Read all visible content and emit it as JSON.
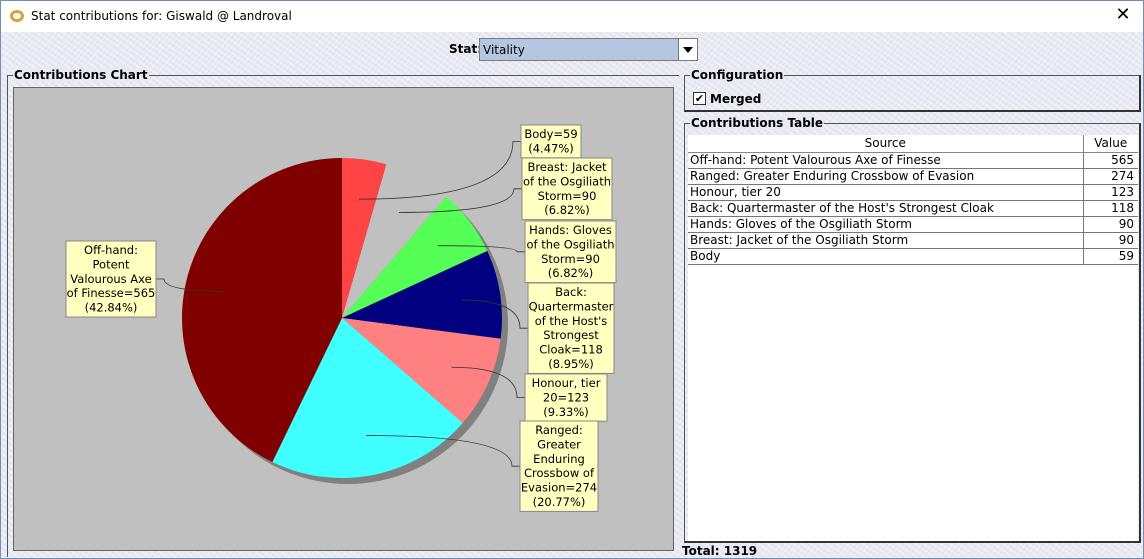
{
  "window": {
    "title": "Stat contributions for: Giswald @ Landroval",
    "close_glyph": "✕"
  },
  "stat": {
    "label": "Stat:",
    "selected": "Vitality"
  },
  "chart_panel": {
    "title": "Contributions Chart"
  },
  "config_panel": {
    "title": "Configuration",
    "merged_label": "Merged",
    "merged_checked": true,
    "check_glyph": "✔"
  },
  "table_panel": {
    "title": "Contributions Table",
    "columns": [
      "Source",
      "Value"
    ],
    "rows": [
      {
        "source": "Off-hand: Potent Valourous Axe of Finesse",
        "value": "565"
      },
      {
        "source": "Ranged: Greater Enduring Crossbow of Evasion",
        "value": "274"
      },
      {
        "source": "Honour, tier 20",
        "value": "123"
      },
      {
        "source": "Back: Quartermaster of the Host's Strongest Cloak",
        "value": "118"
      },
      {
        "source": "Hands: Gloves of the Osgiliath Storm",
        "value": "90"
      },
      {
        "source": "Breast: Jacket of the Osgiliath Storm",
        "value": "90"
      },
      {
        "source": "Body",
        "value": "59"
      }
    ]
  },
  "total": "Total: 1319",
  "chart_data": {
    "type": "pie",
    "title": "",
    "slices": [
      {
        "label": "Body",
        "value": 59,
        "percent": "4.47%",
        "color": "#ff4444",
        "text": [
          "Body=59",
          "(4.47%)"
        ]
      },
      {
        "label": "Breast: Jacket of the Osgiliath Storm",
        "value": 90,
        "percent": "6.82%",
        "color": "#c0c0c0",
        "text": [
          "Breast: Jacket",
          "of the Osgiliath",
          "Storm=90",
          "(6.82%)"
        ]
      },
      {
        "label": "Hands: Gloves of the Osgiliath Storm",
        "value": 90,
        "percent": "6.82%",
        "color": "#55ff55",
        "text": [
          "Hands: Gloves",
          "of the Osgiliath",
          "Storm=90",
          "(6.82%)"
        ]
      },
      {
        "label": "Back: Quartermaster of the Host's Strongest Cloak",
        "value": 118,
        "percent": "8.95%",
        "color": "#000080",
        "text": [
          "Back:",
          "Quartermaster",
          "of the Host's",
          "Strongest",
          "Cloak=118",
          "(8.95%)"
        ]
      },
      {
        "label": "Honour, tier 20",
        "value": 123,
        "percent": "9.33%",
        "color": "#ff8080",
        "text": [
          "Honour, tier",
          "20=123",
          "(9.33%)"
        ]
      },
      {
        "label": "Ranged: Greater Enduring Crossbow of Evasion",
        "value": 274,
        "percent": "20.77%",
        "color": "#40ffff",
        "text": [
          "Ranged:",
          "Greater",
          "Enduring",
          "Crossbow of",
          "Evasion=274",
          "(20.77%)"
        ]
      },
      {
        "label": "Off-hand: Potent Valourous Axe of Finesse",
        "value": 565,
        "percent": "42.84%",
        "color": "#800000",
        "text": [
          "Off-hand:",
          "Potent",
          "Valourous Axe",
          "of Finesse=565",
          "(42.84%)"
        ]
      }
    ]
  }
}
